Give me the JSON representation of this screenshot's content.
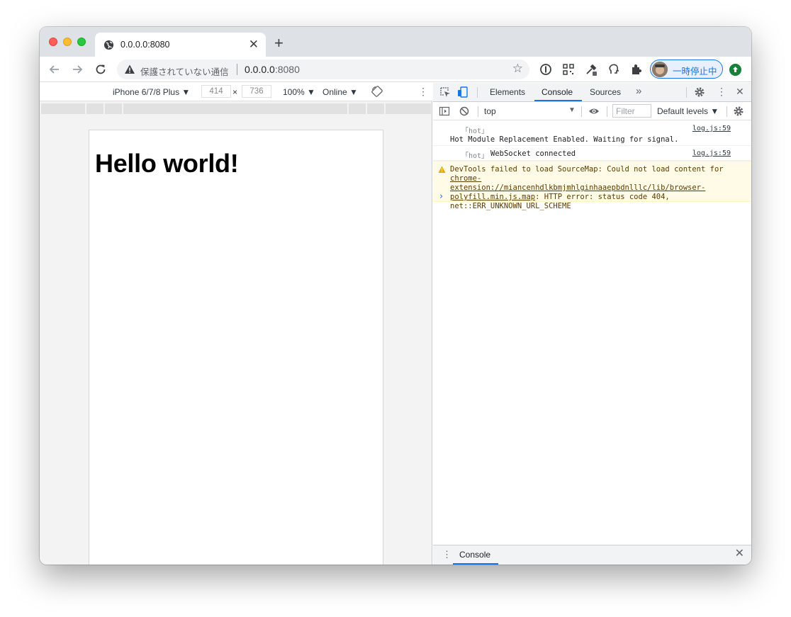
{
  "browser": {
    "tab_title": "0.0.0.0:8080",
    "security_label": "保護されていない通信",
    "url_host": "0.0.0.0",
    "url_port": ":8080",
    "profile_label": "一時停止中"
  },
  "device_toolbar": {
    "device": "iPhone 6/7/8 Plus ▼",
    "width": "414",
    "height": "736",
    "dim_separator": "×",
    "zoom": "100% ▼",
    "throttle": "Online ▼"
  },
  "page": {
    "heading": "Hello world!"
  },
  "devtools": {
    "tabs": [
      "Elements",
      "Console",
      "Sources"
    ],
    "more_tabs": "»",
    "context": "top",
    "filter_placeholder": "Filter",
    "levels": "Default levels ▼",
    "drawer_tab": "Console"
  },
  "console": {
    "messages": [
      {
        "tag": "｢hot｣",
        "text": "Hot Module Replacement Enabled. Waiting for signal.",
        "source": "log.js:59"
      },
      {
        "tag": "｢hot｣",
        "text": "WebSocket connected",
        "source": "log.js:59"
      }
    ],
    "warning": {
      "part1": "DevTools failed to load SourceMap: Could not load content for ",
      "link": "chrome-extension://miancenhdlkbmjmhlginhaaepbdnlllc/lib/browser-polyfill.min.js.map",
      "part2": ": HTTP error: status code 404, net::ERR_UNKNOWN_URL_SCHEME"
    },
    "prompt": "›"
  },
  "colors": {
    "accent": "#1a73e8",
    "warning_bg": "#fffbe6",
    "update_badge": "#188038"
  }
}
